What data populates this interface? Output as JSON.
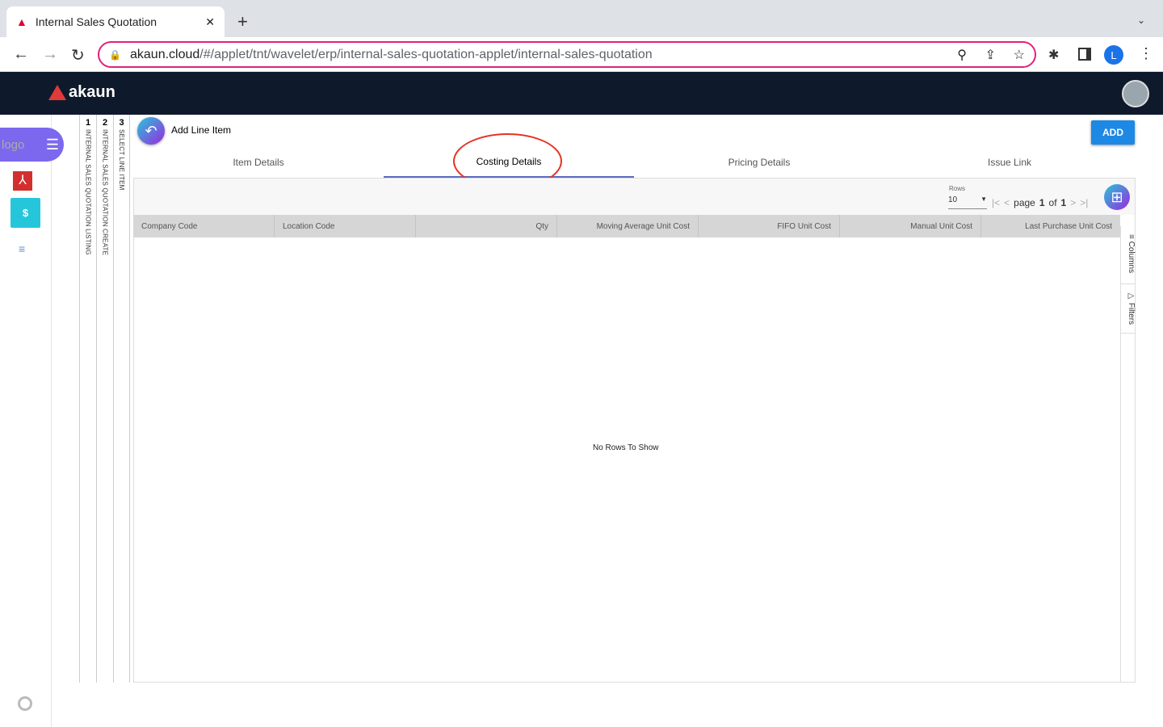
{
  "browser": {
    "tab_title": "Internal Sales Quotation",
    "url_host": "akaun.cloud",
    "url_path": "/#/applet/tnt/wavelet/erp/internal-sales-quotation-applet/internal-sales-quotation",
    "profile_initial": "L"
  },
  "app": {
    "brand": "akaun",
    "logo_alt": "logo"
  },
  "steps": [
    {
      "num": "1",
      "label": "INTERNAL SALES QUOTATION LISTING"
    },
    {
      "num": "2",
      "label": "INTERNAL SALES QUOTATION CREATE"
    },
    {
      "num": "3",
      "label": "SELECT LINE ITEM"
    }
  ],
  "page": {
    "title": "Add Line Item",
    "add_label": "ADD"
  },
  "tabs": [
    "Item Details",
    "Costing Details",
    "Pricing Details",
    "Issue Link"
  ],
  "pager": {
    "rows_label": "Rows",
    "rows_value": "10",
    "page_word": "page",
    "page": "1",
    "of_word": "of",
    "total": "1"
  },
  "columns": [
    "Company Code",
    "Location Code",
    "Qty",
    "Moving Average Unit Cost",
    "FIFO Unit Cost",
    "Manual Unit Cost",
    "Last Purchase Unit Cost"
  ],
  "side_panel": {
    "columns": "Columns",
    "filters": "Filters"
  },
  "empty": "No Rows To Show"
}
